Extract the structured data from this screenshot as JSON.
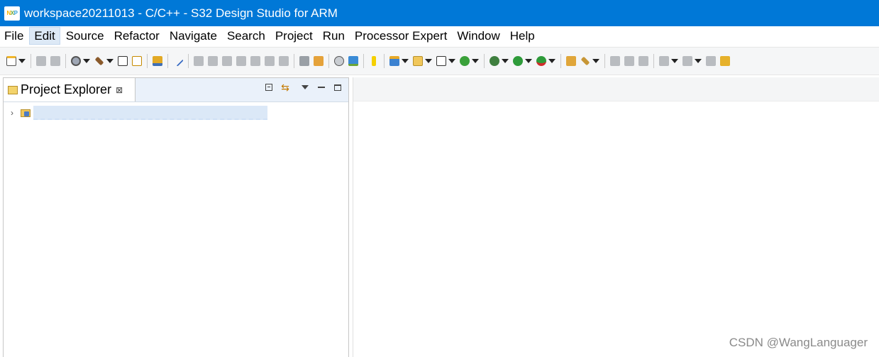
{
  "window": {
    "title": "workspace20211013 - C/C++ - S32 Design Studio for ARM",
    "logo_letters": {
      "n": "N",
      "x": "X",
      "p": "P"
    }
  },
  "menu": {
    "items": [
      {
        "label": "File"
      },
      {
        "label": "Edit",
        "active": true
      },
      {
        "label": "Source"
      },
      {
        "label": "Refactor"
      },
      {
        "label": "Navigate"
      },
      {
        "label": "Search"
      },
      {
        "label": "Project"
      },
      {
        "label": "Run"
      },
      {
        "label": "Processor Expert"
      },
      {
        "label": "Window"
      },
      {
        "label": "Help"
      }
    ]
  },
  "project_explorer": {
    "tab_label": "Project Explorer",
    "close_glyph": "⊠",
    "tree_chevron": "›",
    "link_glyph": "⇆"
  },
  "watermark": "CSDN @WangLanguager",
  "colors": {
    "titlebar": "#0078d7",
    "menu_active": "#dde9f6",
    "view_header": "#eaf1fa"
  }
}
